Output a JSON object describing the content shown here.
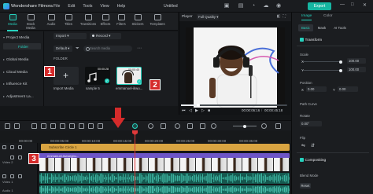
{
  "app": {
    "name": "Wondershare Filmora",
    "menu": [
      "File",
      "Edit",
      "Tools",
      "View",
      "Help"
    ],
    "document_title": "Untitled",
    "export_label": "Export"
  },
  "media_tabs": [
    "Media",
    "Stock Media",
    "Audio",
    "Titles",
    "Transitions",
    "Effects",
    "Filters",
    "Stickers",
    "Templates"
  ],
  "sidebar": {
    "project_media": "Project Media",
    "folder": "Folder",
    "items": [
      "Global Media",
      "Cloud Media",
      "Influence Kit",
      "Adjustment La..."
    ]
  },
  "media": {
    "import_label": "Import",
    "record_label": "Record",
    "default_label": "Default",
    "search_placeholder": "Search media",
    "folder_heading": "FOLDER",
    "items": [
      {
        "label": "Import Media"
      },
      {
        "label": "sample 5",
        "duration": "00:00:28"
      },
      {
        "label": "emmanuel-ikwu...",
        "duration": "00:00:45"
      }
    ]
  },
  "player": {
    "label": "Player",
    "quality": "Full Quality",
    "current_time": "00:00:06:16",
    "total_time": "00:00:45:18",
    "progress": 0.16
  },
  "right_panel": {
    "tabs": [
      "Image",
      "Color"
    ],
    "sub_tabs": [
      "Basic",
      "Mask",
      "AI Tools"
    ],
    "transform": "Transform",
    "scale_label": "Scale",
    "scale_x": "100.00",
    "scale_y": "100.00",
    "position_label": "Position",
    "position_x": "0.00",
    "position_y": "0.00",
    "path_curve": "Path Curve",
    "rotate_label": "Rotate",
    "rotate_value": "0.00°",
    "flip_label": "Flip",
    "compositing": "Compositing",
    "blend_mode": "Blend Mode",
    "reset": "Reset"
  },
  "timeline": {
    "ticks": [
      "00:00:00",
      "00:00:05:00",
      "00:00:10:00",
      "00:00:15:00",
      "00:00:20:00",
      "00:00:25:00",
      "00:00:30:00",
      "00:00:35:00"
    ],
    "title_clip": "Subscribe Circle 1",
    "video_clip": "emmanuel-ikwuegbu...",
    "track_labels": [
      "Video 2",
      "Video 1",
      "Audio 1"
    ]
  },
  "annotations": [
    "1",
    "2",
    "3"
  ],
  "colors": {
    "accent": "#26d1bd",
    "export": "#16b5a1",
    "annotation": "#d52b2b",
    "title_clip": "#d9a441",
    "video_clip": "#8b3f9e",
    "audio_clip": "#15584f",
    "playhead": "#e0393a"
  }
}
